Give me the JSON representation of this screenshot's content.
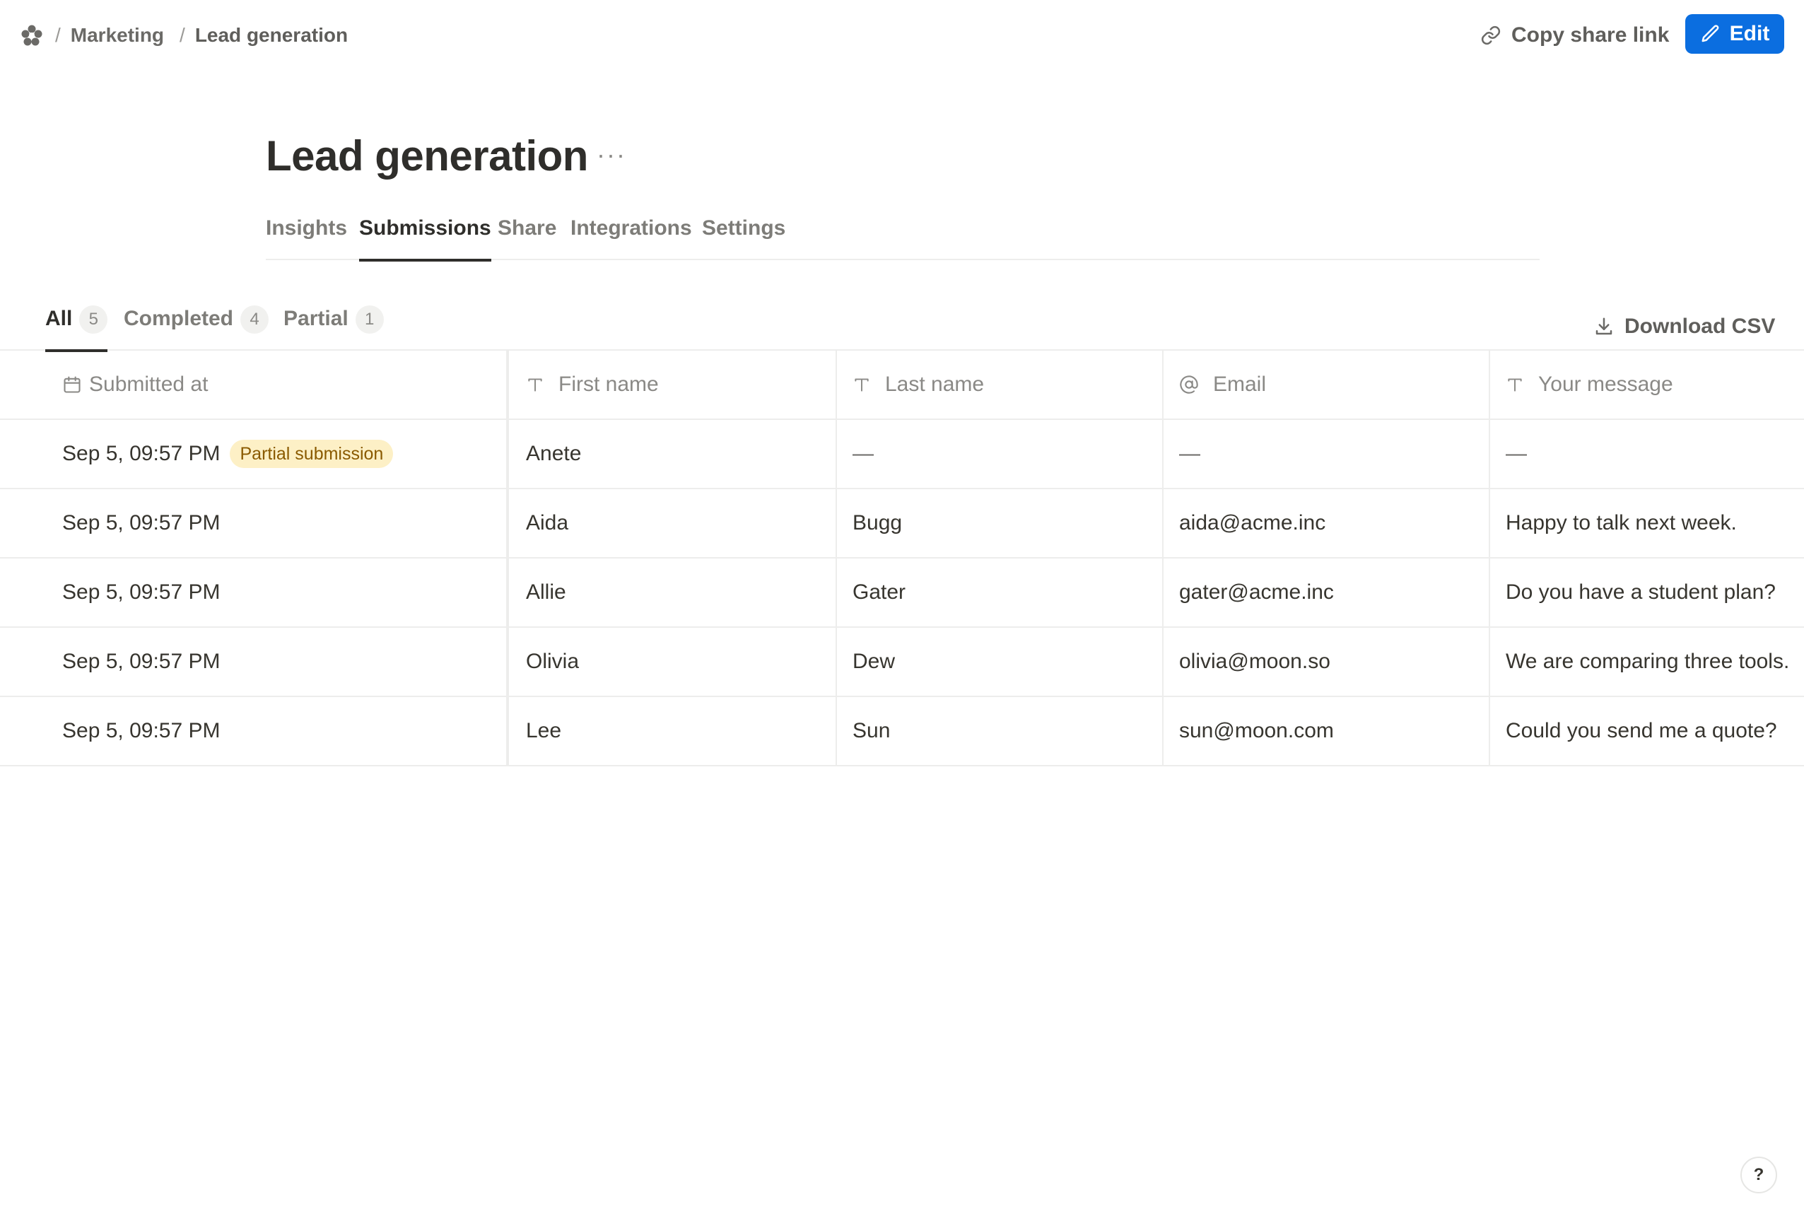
{
  "breadcrumb": {
    "separator": "/",
    "items": [
      "Marketing",
      "Lead generation"
    ]
  },
  "header": {
    "copy_link_label": "Copy share link",
    "edit_label": "Edit",
    "accent_color": "#0b6ee0"
  },
  "page": {
    "title": "Lead generation",
    "more": "···"
  },
  "main_tabs": [
    {
      "label": "Insights",
      "active": false
    },
    {
      "label": "Submissions",
      "active": true
    },
    {
      "label": "Share",
      "active": false
    },
    {
      "label": "Integrations",
      "active": false
    },
    {
      "label": "Settings",
      "active": false
    }
  ],
  "filters": [
    {
      "label": "All",
      "count": "5",
      "active": true
    },
    {
      "label": "Completed",
      "count": "4",
      "active": false
    },
    {
      "label": "Partial",
      "count": "1",
      "active": false
    }
  ],
  "download_label": "Download CSV",
  "table": {
    "columns": [
      {
        "label": "Submitted at",
        "icon": "calendar-icon"
      },
      {
        "label": "First name",
        "icon": "text-type-icon"
      },
      {
        "label": "Last name",
        "icon": "text-type-icon"
      },
      {
        "label": "Email",
        "icon": "at-sign-icon"
      },
      {
        "label": "Your message",
        "icon": "text-type-icon"
      }
    ],
    "rows": [
      {
        "submitted": "Sep 5, 09:57 PM",
        "badge": "Partial submission",
        "first": "Anete",
        "last": "—",
        "email": "—",
        "message": "—"
      },
      {
        "submitted": "Sep 5, 09:57 PM",
        "first": "Aida",
        "last": "Bugg",
        "email": "aida@acme.inc",
        "message": "Happy to talk next week."
      },
      {
        "submitted": "Sep 5, 09:57 PM",
        "first": "Allie",
        "last": "Gater",
        "email": "gater@acme.inc",
        "message": "Do you have a student plan?"
      },
      {
        "submitted": "Sep 5, 09:57 PM",
        "first": "Olivia",
        "last": "Dew",
        "email": "olivia@moon.so",
        "message": "We are comparing three tools."
      },
      {
        "submitted": "Sep 5, 09:57 PM",
        "first": "Lee",
        "last": "Sun",
        "email": "sun@moon.com",
        "message": "Could you send me a quote?"
      }
    ]
  },
  "help_label": "?"
}
